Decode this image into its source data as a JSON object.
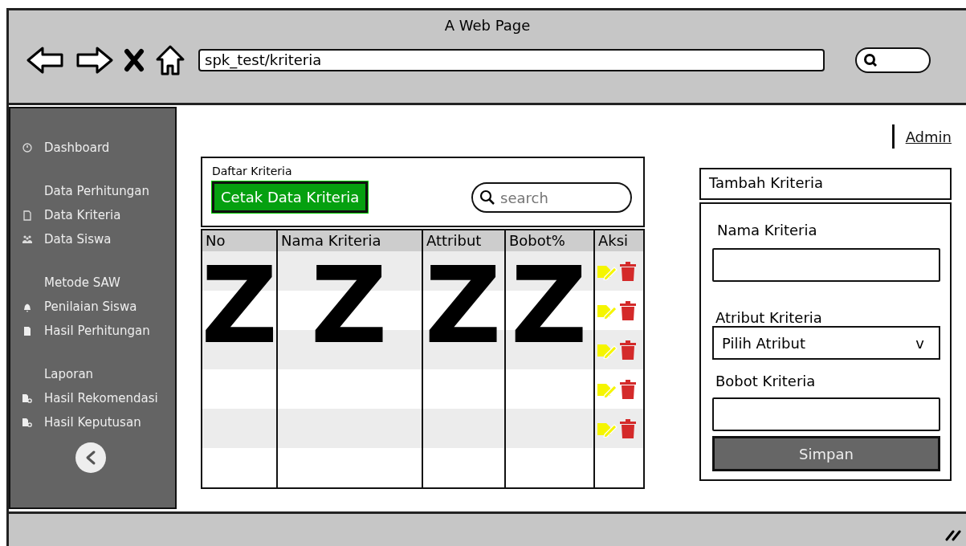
{
  "window": {
    "title": "A Web Page",
    "address": "spk_test/kriteria"
  },
  "sidebar": {
    "items": [
      {
        "kind": "link",
        "label": "Dashboard"
      },
      {
        "kind": "heading",
        "label": "Data Perhitungan"
      },
      {
        "kind": "link",
        "label": "Data Kriteria"
      },
      {
        "kind": "link",
        "label": "Data Siswa"
      },
      {
        "kind": "heading",
        "label": "Metode SAW"
      },
      {
        "kind": "link",
        "label": "Penilaian Siswa"
      },
      {
        "kind": "link",
        "label": "Hasil Perhitungan"
      },
      {
        "kind": "heading",
        "label": "Laporan"
      },
      {
        "kind": "link",
        "label": "Hasil Rekomendasi"
      },
      {
        "kind": "link",
        "label": "Hasil Keputusan"
      }
    ]
  },
  "user": {
    "label": "Admin"
  },
  "list_panel": {
    "title": "Daftar Kriteria",
    "print_button": "Cetak Data Kriteria",
    "search": {
      "placeholder": "search"
    }
  },
  "table": {
    "columns": [
      "No",
      "Nama Kriteria",
      "Attribut",
      "Bobot%",
      "Aksi"
    ],
    "placeholder_marks": [
      "Z",
      "Z",
      "Z",
      "Z"
    ],
    "rows": [
      {
        "actions": true
      },
      {
        "actions": true
      },
      {
        "actions": true
      },
      {
        "actions": true
      },
      {
        "actions": true
      }
    ]
  },
  "form": {
    "title": "Tambah Kriteria",
    "fields": [
      {
        "kind": "text",
        "label": "Nama Kriteria"
      },
      {
        "kind": "select",
        "label": "Atribut Kriteria",
        "value": "Pilih Atribut",
        "caret": "v"
      },
      {
        "kind": "text",
        "label": "Bobot Kriteria"
      }
    ],
    "submit": "Simpan"
  }
}
